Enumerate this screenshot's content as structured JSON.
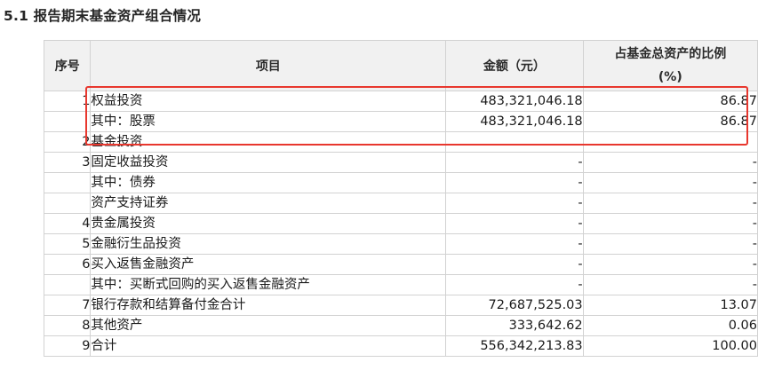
{
  "section_title": "5.1 报告期末基金资产组合情况",
  "table": {
    "headers": {
      "no": "序号",
      "item": "项目",
      "amount": "金额（元）",
      "ratio_line1": "占基金总资产的比例",
      "ratio_line2": "(%)"
    },
    "rows": [
      {
        "no": "1",
        "item": "权益投资",
        "amount": "483,321,046.18",
        "ratio": "86.87"
      },
      {
        "no": "",
        "item": "其中：股票",
        "amount": "483,321,046.18",
        "ratio": "86.87"
      },
      {
        "no": "2",
        "item": "基金投资",
        "amount": "",
        "ratio": ""
      },
      {
        "no": "3",
        "item": "固定收益投资",
        "amount": "-",
        "ratio": "-"
      },
      {
        "no": "",
        "item": "其中：债券",
        "amount": "-",
        "ratio": "-"
      },
      {
        "no": "",
        "item": "资产支持证券",
        "amount": "-",
        "ratio": "-"
      },
      {
        "no": "4",
        "item": "贵金属投资",
        "amount": "-",
        "ratio": "-"
      },
      {
        "no": "5",
        "item": "金融衍生品投资",
        "amount": "-",
        "ratio": "-"
      },
      {
        "no": "6",
        "item": "买入返售金融资产",
        "amount": "-",
        "ratio": "-"
      },
      {
        "no": "",
        "item": "其中：买断式回购的买入返售金融资产",
        "amount": "-",
        "ratio": "-"
      },
      {
        "no": "7",
        "item": "银行存款和结算备付金合计",
        "amount": "72,687,525.03",
        "ratio": "13.07"
      },
      {
        "no": "8",
        "item": "其他资产",
        "amount": "333,642.62",
        "ratio": "0.06"
      },
      {
        "no": "9",
        "item": "合计",
        "amount": "556,342,213.83",
        "ratio": "100.00"
      }
    ]
  },
  "annotation": {
    "color": "#e8372e",
    "highlighted_rows": [
      0,
      1
    ]
  }
}
